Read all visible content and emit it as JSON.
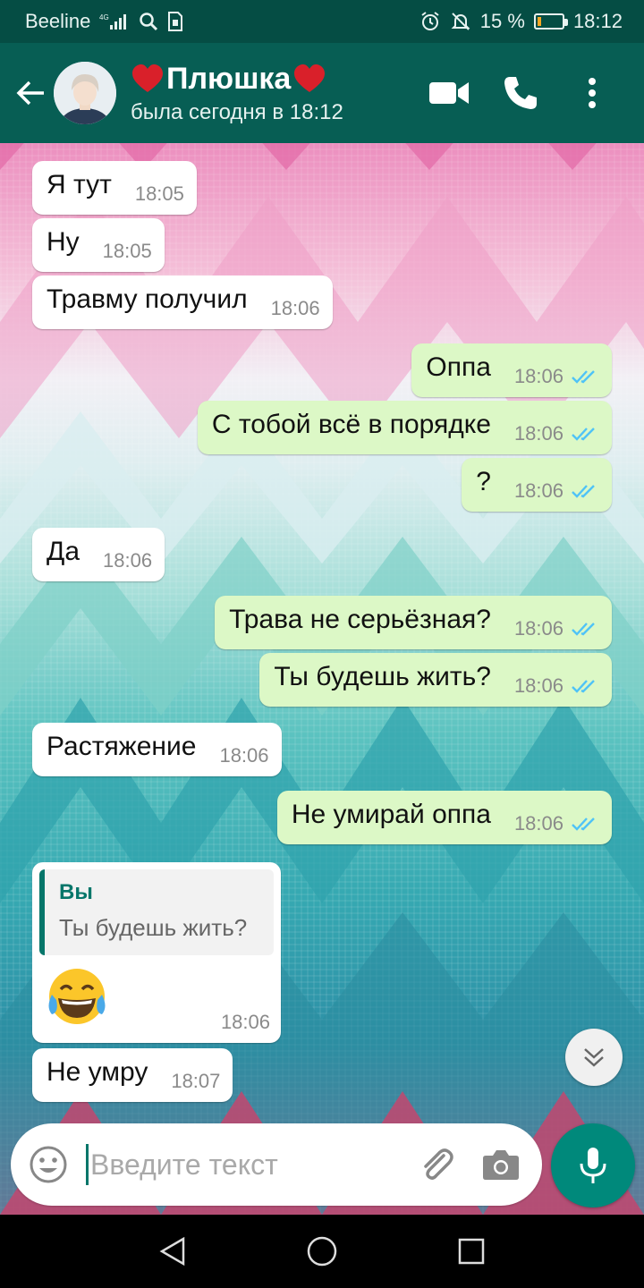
{
  "status_bar": {
    "carrier": "Beeline",
    "network": "4G",
    "battery": "15 %",
    "battery_level": 0.15,
    "time": "18:12",
    "icons": [
      "signal-icon",
      "search-icon",
      "sim-icon",
      "alarm-icon",
      "mute-icon",
      "battery-icon"
    ]
  },
  "header": {
    "name": "Плюшка",
    "heart_icon": "red-heart-emoji",
    "status": "была сегодня в 18:12",
    "icons": [
      "back-arrow-icon",
      "video-call-icon",
      "phone-icon",
      "more-icon"
    ]
  },
  "messages": [
    {
      "dir": "in",
      "text": "Я тут",
      "time": "18:05"
    },
    {
      "dir": "in",
      "text": "Ну",
      "time": "18:05"
    },
    {
      "dir": "in",
      "text": "Травму получил",
      "time": "18:06"
    },
    {
      "dir": "out",
      "text": "Оппа",
      "time": "18:06",
      "read": true
    },
    {
      "dir": "out",
      "text": "С тобой всё в порядке",
      "time": "18:06",
      "read": true
    },
    {
      "dir": "out",
      "text": "?",
      "time": "18:06",
      "read": true
    },
    {
      "dir": "in",
      "text": "Да",
      "time": "18:06"
    },
    {
      "dir": "out",
      "text": "Трава не серьёзная?",
      "time": "18:06",
      "read": true
    },
    {
      "dir": "out",
      "text": "Ты будешь жить?",
      "time": "18:06",
      "read": true
    },
    {
      "dir": "in",
      "text": "Растяжение",
      "time": "18:06"
    },
    {
      "dir": "out",
      "text": "Не умирай оппа",
      "time": "18:06",
      "read": true
    },
    {
      "dir": "in",
      "type": "reply",
      "quote_author": "Вы",
      "quote_text": "Ты будешь жить?",
      "emoji": "tears-of-joy-emoji",
      "time": "18:06"
    },
    {
      "dir": "in",
      "text": "Не умру",
      "time": "18:07"
    }
  ],
  "composer": {
    "placeholder": "Введите текст",
    "value": "",
    "icons": [
      "emoji-icon",
      "attach-icon",
      "camera-icon",
      "mic-icon"
    ]
  },
  "colors": {
    "header": "#075e54",
    "status_bar": "#054d44",
    "outgoing_bubble": "#dcf8c6",
    "incoming_bubble": "#ffffff",
    "accent": "#00897b",
    "read_ticks": "#4fc3f7"
  },
  "nav_bar": {
    "icons": [
      "back-triangle-icon",
      "home-circle-icon",
      "recents-square-icon"
    ]
  }
}
